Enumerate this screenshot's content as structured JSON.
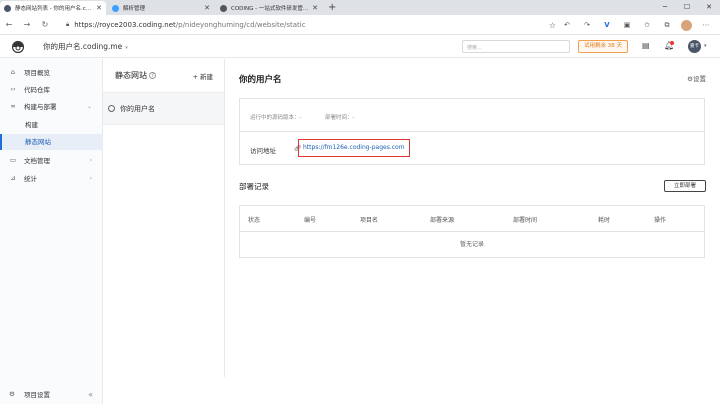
{
  "browser": {
    "tabs": [
      {
        "title": "静态网站列表 - 你的用户名.coding.me",
        "favicon_color": "#4a5568",
        "active": true
      },
      {
        "title": "解析管理",
        "favicon_color": "#3aa0ff",
        "active": false
      },
      {
        "title": "CODING - 一站式软件研发管理平台",
        "favicon_color": "#555555",
        "active": false
      }
    ],
    "url_host": "https://royce2003.coding.net",
    "url_path": "/p/nideyonghuming/cd/website/static"
  },
  "header": {
    "team_name": "你的用户名.coding.me",
    "search_placeholder": "搜索...",
    "trial_label": "试用剩余 38 天",
    "user_initials": "嘉卡"
  },
  "sidebar": {
    "items": [
      {
        "label": "项目概览",
        "icon": "home-icon"
      },
      {
        "label": "代码仓库",
        "icon": "code-icon"
      },
      {
        "label": "构建与部署",
        "icon": "infinity-icon",
        "expanded": true
      },
      {
        "label": "文档管理",
        "icon": "doc-icon"
      },
      {
        "label": "统计",
        "icon": "chart-icon"
      }
    ],
    "subitems": [
      {
        "label": "构建"
      },
      {
        "label": "静态网站",
        "active": true
      }
    ],
    "settings_label": "项目设置"
  },
  "midpanel": {
    "title": "静态网站",
    "new_label": "新建",
    "site_name": "你的用户名"
  },
  "main": {
    "title": "你的用户名",
    "settings_label": "设置",
    "running_version_label": "运行中的源码版本：-",
    "deploy_time_label": "部署时间：-",
    "visit_label": "访问地址",
    "visit_url": "https://fm126e.coding-pages.com",
    "deploy_section_title": "部署记录",
    "deploy_now_label": "立即部署",
    "table_headers": [
      "状态",
      "编号",
      "项目名",
      "部署来源",
      "部署时间",
      "耗时",
      "操作"
    ],
    "empty_text": "暂无记录"
  }
}
